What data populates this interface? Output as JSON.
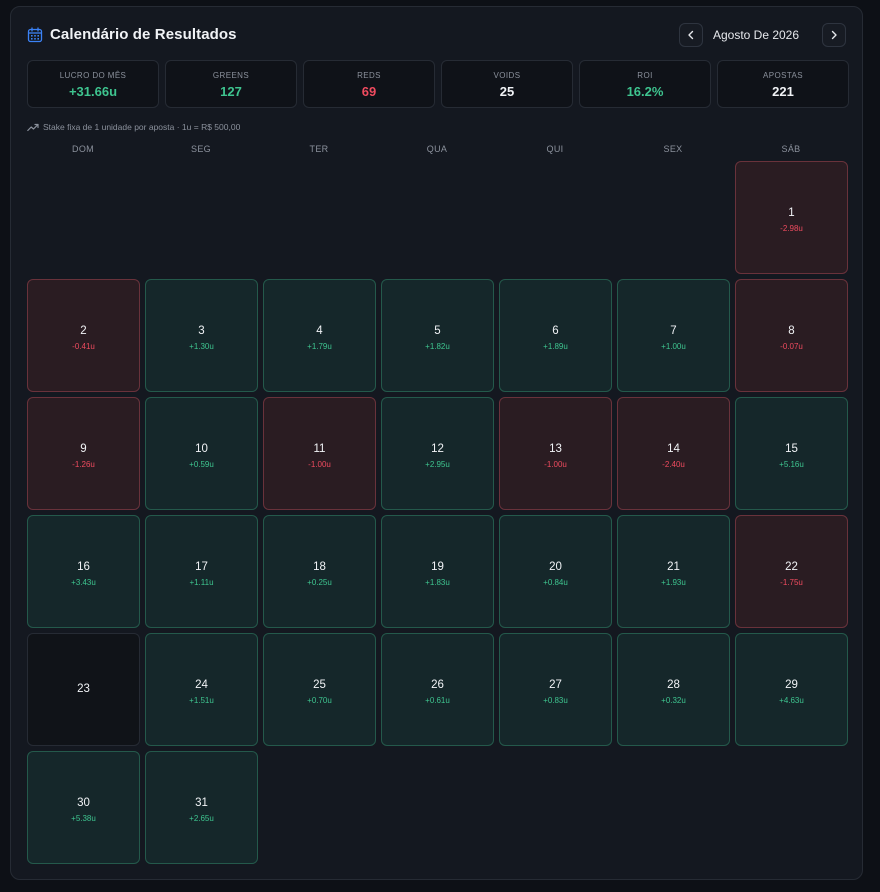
{
  "header": {
    "title": "Calendário de Resultados",
    "month": "Agosto De 2026",
    "icons": {
      "calendar": "calendar-icon",
      "prev": "chevron-left-icon",
      "next": "chevron-right-icon"
    }
  },
  "stats": [
    {
      "label": "LUCRO DO MÊS",
      "value": "+31.66u",
      "tone": "pos"
    },
    {
      "label": "GREENS",
      "value": "127",
      "tone": "pos"
    },
    {
      "label": "REDS",
      "value": "69",
      "tone": "neg"
    },
    {
      "label": "VOIDS",
      "value": "25",
      "tone": "white"
    },
    {
      "label": "ROI",
      "value": "16.2%",
      "tone": "pos"
    },
    {
      "label": "APOSTAS",
      "value": "221",
      "tone": "white"
    }
  ],
  "note": "Stake fixa de 1 unidade por aposta · 1u = R$ 500,00",
  "weekdays": [
    "DOM",
    "SEG",
    "TER",
    "QUA",
    "QUI",
    "SEX",
    "SÁB"
  ],
  "first_weekday_index": 6,
  "days": [
    {
      "day": "1",
      "value": "-2.98u",
      "tone": "neg"
    },
    {
      "day": "2",
      "value": "-0.41u",
      "tone": "neg"
    },
    {
      "day": "3",
      "value": "+1.30u",
      "tone": "pos"
    },
    {
      "day": "4",
      "value": "+1.79u",
      "tone": "pos"
    },
    {
      "day": "5",
      "value": "+1.82u",
      "tone": "pos"
    },
    {
      "day": "6",
      "value": "+1.89u",
      "tone": "pos"
    },
    {
      "day": "7",
      "value": "+1.00u",
      "tone": "pos"
    },
    {
      "day": "8",
      "value": "-0.07u",
      "tone": "neg"
    },
    {
      "day": "9",
      "value": "-1.26u",
      "tone": "neg"
    },
    {
      "day": "10",
      "value": "+0.59u",
      "tone": "pos"
    },
    {
      "day": "11",
      "value": "-1.00u",
      "tone": "neg"
    },
    {
      "day": "12",
      "value": "+2.95u",
      "tone": "pos"
    },
    {
      "day": "13",
      "value": "-1.00u",
      "tone": "neg"
    },
    {
      "day": "14",
      "value": "-2.40u",
      "tone": "neg"
    },
    {
      "day": "15",
      "value": "+5.16u",
      "tone": "pos"
    },
    {
      "day": "16",
      "value": "+3.43u",
      "tone": "pos"
    },
    {
      "day": "17",
      "value": "+1.11u",
      "tone": "pos"
    },
    {
      "day": "18",
      "value": "+0.25u",
      "tone": "pos"
    },
    {
      "day": "19",
      "value": "+1.83u",
      "tone": "pos"
    },
    {
      "day": "20",
      "value": "+0.84u",
      "tone": "pos"
    },
    {
      "day": "21",
      "value": "+1.93u",
      "tone": "pos"
    },
    {
      "day": "22",
      "value": "-1.75u",
      "tone": "neg"
    },
    {
      "day": "23",
      "value": "",
      "tone": "zero"
    },
    {
      "day": "24",
      "value": "+1.51u",
      "tone": "pos"
    },
    {
      "day": "25",
      "value": "+0.70u",
      "tone": "pos"
    },
    {
      "day": "26",
      "value": "+0.61u",
      "tone": "pos"
    },
    {
      "day": "27",
      "value": "+0.83u",
      "tone": "pos"
    },
    {
      "day": "28",
      "value": "+0.32u",
      "tone": "pos"
    },
    {
      "day": "29",
      "value": "+4.63u",
      "tone": "pos"
    },
    {
      "day": "30",
      "value": "+5.38u",
      "tone": "pos"
    },
    {
      "day": "31",
      "value": "+2.65u",
      "tone": "pos"
    }
  ],
  "colors": {
    "positive": "#3ec48f",
    "negative": "#ef4b5f",
    "accent": "#3b82f6"
  }
}
